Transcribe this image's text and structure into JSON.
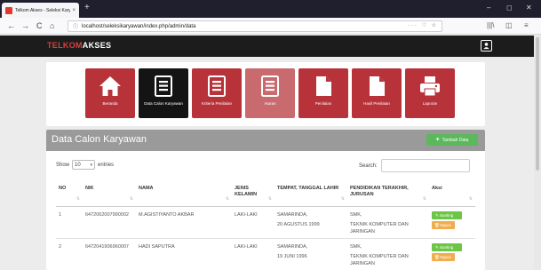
{
  "browser": {
    "tab_title": "Telkom Akses - Seleksi Karyaw",
    "tab_close": "×",
    "new_tab": "+",
    "url": "localhost/seleksikaryawan/index.php/admin/data",
    "url_actions": "··· ♡ ☆",
    "window_controls": {
      "minimize": "–",
      "maximize": "◻",
      "close": "✕"
    },
    "nav": {
      "back": "←",
      "forward": "→",
      "reload": "C",
      "home": "⌂"
    },
    "right_icons": {
      "library": "|||\\",
      "sidebar": "◫",
      "menu": "≡"
    }
  },
  "app": {
    "brand_part1": "TELKOM",
    "brand_part2": "AKSES",
    "user_icon": "user-icon"
  },
  "menu": [
    {
      "label": "Beranda",
      "icon": "home-icon"
    },
    {
      "label": "Data Calon Karyawan",
      "icon": "list-icon",
      "active": true
    },
    {
      "label": "Kriteria Penilaian",
      "icon": "list-icon"
    },
    {
      "label": "Aturan",
      "icon": "list-icon"
    },
    {
      "label": "Penilaian",
      "icon": "file-icon"
    },
    {
      "label": "Hasil Penilaian",
      "icon": "file-icon"
    },
    {
      "label": "Laporan",
      "icon": "printer-icon"
    }
  ],
  "card": {
    "title": "Data Calon Karyawan",
    "add_button": "Tambah Data",
    "show_label": "Show",
    "entries_value": "10",
    "entries_label": "entries",
    "search_label": "Search:",
    "search_value": ""
  },
  "table": {
    "columns": [
      "NO",
      "NIK",
      "NAMA",
      "JENIS KELAMIN",
      "TEMPAT, TANGGAL LAHIR",
      "PENDIDIKAN TERAKHIR, JURUSAN",
      "Aksi"
    ],
    "rows": [
      {
        "no": "1",
        "nik": "6472062007990002",
        "nama": "M.AGISTIYANTO AKBAR",
        "jk": "LAKI-LAKI",
        "tempat": "SAMARINDA,",
        "tanggal": "20 AGUSTUS 1999",
        "pendidikan": "SMK,",
        "jurusan": "TEKNIK KOMPUTER DAN JARINGAN"
      },
      {
        "no": "2",
        "nik": "6472041906960007",
        "nama": "HADI SAPUTRA",
        "jk": "LAKI-LAKI",
        "tempat": "SAMARINDA,",
        "tanggal": "19 JUNI 1996",
        "pendidikan": "SMK,",
        "jurusan": "TEKNIK KOMPUTER DAN JARINGAN"
      }
    ],
    "edit_label": "Sunting",
    "delete_label": "Hapus"
  },
  "colors": {
    "brand_red": "#d9413b",
    "tile_red": "#b8323a",
    "tile_active": "#141414",
    "header_grey": "#9a9a9a",
    "add_green": "#5cb85c",
    "edit_green": "#6cc644",
    "delete_orange": "#f0ad4e"
  }
}
